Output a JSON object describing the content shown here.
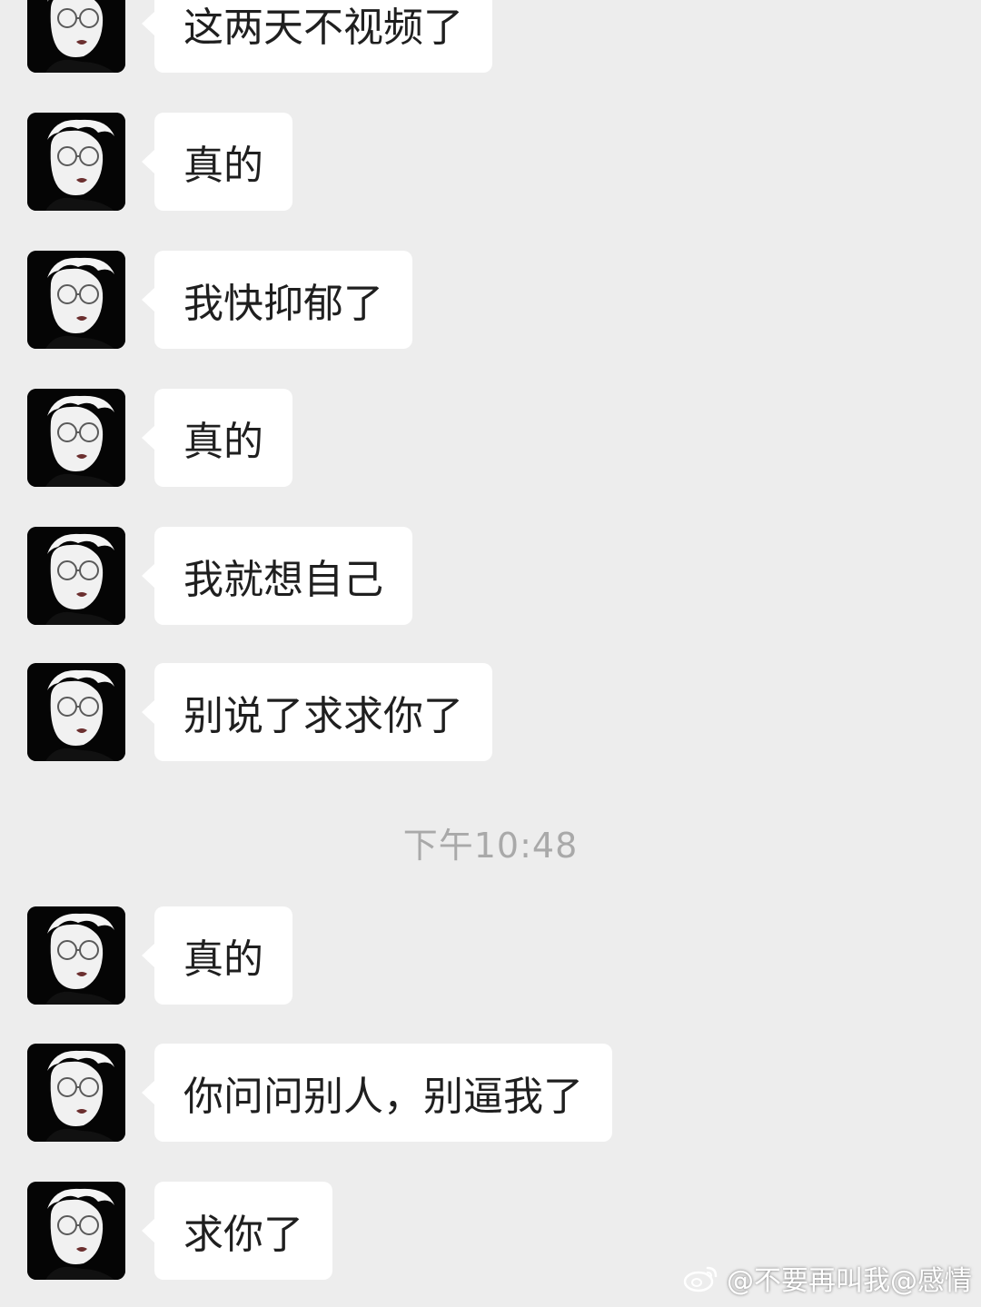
{
  "conversation": {
    "messages_before": [
      {
        "text": "这两天不视频了"
      },
      {
        "text": "真的"
      },
      {
        "text": "我快抑郁了"
      },
      {
        "text": "真的"
      },
      {
        "text": "我就想自己"
      },
      {
        "text": "别说了求求你了"
      }
    ],
    "timestamp": "下午10:48",
    "messages_after": [
      {
        "text": "真的"
      },
      {
        "text": "你问问别人，别逼我了"
      },
      {
        "text": "求你了"
      }
    ]
  },
  "watermark": {
    "icon": "weibo-logo-icon",
    "text": "@不要再叫我@感情"
  },
  "colors": {
    "background": "#ededed",
    "bubble": "#ffffff",
    "avatar_bg": "#050505",
    "timestamp": "#a9a9a9"
  }
}
